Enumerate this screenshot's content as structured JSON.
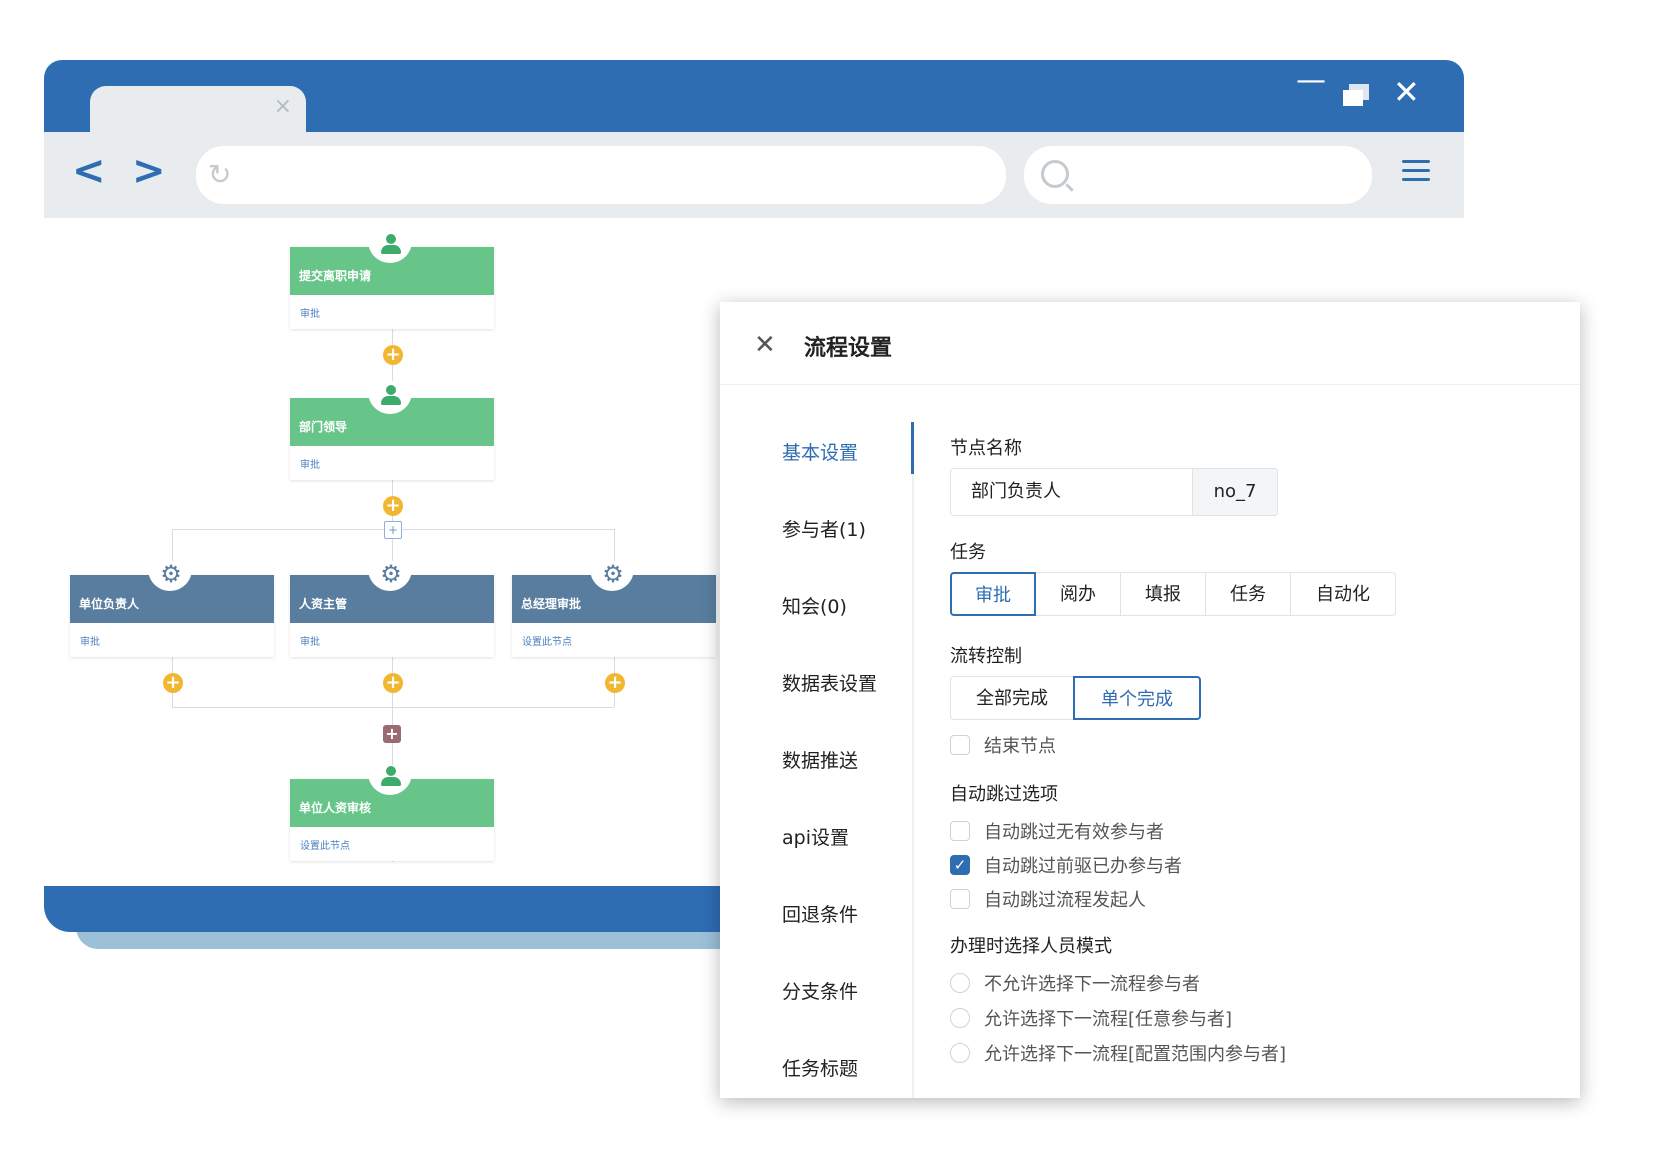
{
  "browser": {
    "tab_close": "×",
    "min": "—",
    "close": "✕",
    "back": "<",
    "forward": ">",
    "reload": "↻"
  },
  "flow": {
    "nodes": [
      {
        "title": "提交离职申请",
        "sub": "审批"
      },
      {
        "title": "部门领导",
        "sub": "审批"
      },
      {
        "title": "单位负责人",
        "sub": "审批"
      },
      {
        "title": "人资主管",
        "sub": "审批"
      },
      {
        "title": "总经理审批",
        "sub": "设置此节点"
      },
      {
        "title": "单位人资审核",
        "sub": "设置此节点"
      }
    ],
    "add_symbol": "+",
    "gear_symbol": "⚙"
  },
  "panel": {
    "close": "✕",
    "title": "流程设置",
    "nav": [
      "基本设置",
      "参与者(1)",
      "知会(0)",
      "数据表设置",
      "数据推送",
      "api设置",
      "回退条件",
      "分支条件",
      "任务标题"
    ],
    "active_nav": "基本设置",
    "node_name_label": "节点名称",
    "node_name_value": "部门负责人",
    "node_id": "no_7",
    "task_label": "任务",
    "task_options": [
      "审批",
      "阅办",
      "填报",
      "任务",
      "自动化"
    ],
    "task_selected": "审批",
    "flow_ctrl_label": "流转控制",
    "flow_ctrl_options": [
      "全部完成",
      "单个完成"
    ],
    "flow_ctrl_selected": "单个完成",
    "end_node_label": "结束节点",
    "end_node_checked": false,
    "auto_skip_label": "自动跳过选项",
    "auto_skip": [
      {
        "label": "自动跳过无有效参与者",
        "checked": false
      },
      {
        "label": "自动跳过前驱已办参与者",
        "checked": true
      },
      {
        "label": "自动跳过流程发起人",
        "checked": false
      }
    ],
    "select_mode_label": "办理时选择人员模式",
    "select_mode": [
      "不允许选择下一流程参与者",
      "允许选择下一流程[任意参与者]",
      "允许选择下一流程[配置范围内参与者]"
    ],
    "accent_color": "#2f6db3"
  }
}
